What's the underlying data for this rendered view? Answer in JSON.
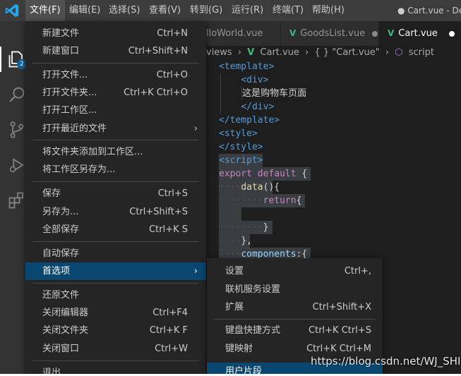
{
  "menubar": {
    "items": [
      {
        "label": "文件(F)"
      },
      {
        "label": "编辑(E)"
      },
      {
        "label": "选择(S)"
      },
      {
        "label": "查看(V)"
      },
      {
        "label": "转到(G)"
      },
      {
        "label": "运行(R)"
      },
      {
        "label": "终端(T)"
      },
      {
        "label": "帮助(H)"
      }
    ],
    "window_title": "● Cart.vue - Dem"
  },
  "activitybar": {
    "explorer_badge": "2"
  },
  "tabs": [
    {
      "label": "lloWorld.vue"
    },
    {
      "label": "GoodsList.vue"
    },
    {
      "label": "Cart.vue"
    }
  ],
  "breadcrumb": {
    "folder": "views",
    "file": "Cart.vue",
    "section": "{ } \"Cart.vue\"",
    "symbol": "script"
  },
  "code": {
    "l1": "<template>",
    "l2": "<div>",
    "l3": "这是购物车页面",
    "l4": "</div>",
    "l5": "</template>",
    "l6": "<style>",
    "l7": "</style>",
    "l8": "<script>",
    "l9_kw": "export default",
    "l9_brace": " {",
    "l10_fn": "data",
    "l10_rest": "(){",
    "l11_kw": "return",
    "l11_rest": "{",
    "l13": "}",
    "l14": "},",
    "l15_prop": "components",
    "l15_rest": ":{"
  },
  "file_menu": {
    "items": [
      {
        "label": "新建文件",
        "shortcut": "Ctrl+N"
      },
      {
        "label": "新建窗口",
        "shortcut": "Ctrl+Shift+N"
      },
      {
        "label": "打开文件...",
        "shortcut": "Ctrl+O"
      },
      {
        "label": "打开文件夹...",
        "shortcut": "Ctrl+K Ctrl+O"
      },
      {
        "label": "打开工作区..."
      },
      {
        "label": "打开最近的文件",
        "arrow": "›"
      },
      {
        "label": "将文件夹添加到工作区..."
      },
      {
        "label": "将工作区另存为..."
      },
      {
        "label": "保存",
        "shortcut": "Ctrl+S"
      },
      {
        "label": "另存为...",
        "shortcut": "Ctrl+Shift+S"
      },
      {
        "label": "全部保存",
        "shortcut": "Ctrl+K S"
      },
      {
        "label": "自动保存"
      },
      {
        "label": "首选项",
        "arrow": "›"
      },
      {
        "label": "还原文件"
      },
      {
        "label": "关闭编辑器",
        "shortcut": "Ctrl+F4"
      },
      {
        "label": "关闭文件夹",
        "shortcut": "Ctrl+K F"
      },
      {
        "label": "关闭窗口",
        "shortcut": "Ctrl+W"
      },
      {
        "label": "退出"
      }
    ]
  },
  "pref_menu": {
    "items": [
      {
        "label": "设置",
        "shortcut": "Ctrl+,"
      },
      {
        "label": "联机服务设置"
      },
      {
        "label": "扩展",
        "shortcut": "Ctrl+Shift+X"
      },
      {
        "label": "键盘快捷方式",
        "shortcut": "Ctrl+K Ctrl+S"
      },
      {
        "label": "键映射",
        "shortcut": "Ctrl+K Ctrl+M"
      },
      {
        "label": "用户片段"
      }
    ]
  },
  "watermark": "https://blog.csdn.net/WJ_SHI",
  "colors": {
    "menubar_bg": "#3c3c3c",
    "menu_bg": "#252526",
    "highlight": "#094771",
    "editor_bg": "#1e1e1e",
    "vue_green": "#41b883",
    "modified_dot": "#c5c5c5"
  }
}
